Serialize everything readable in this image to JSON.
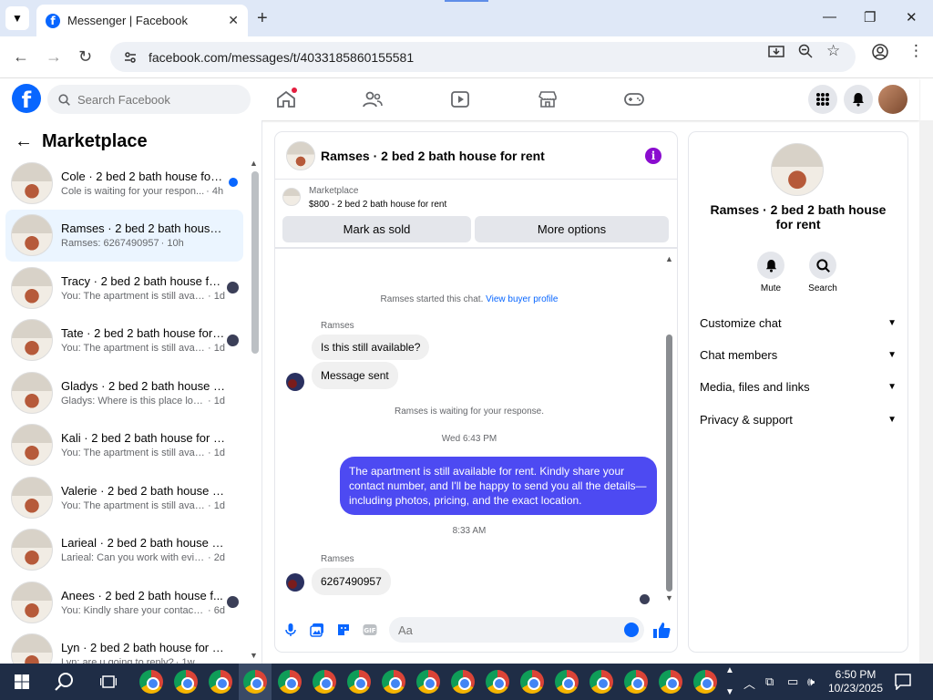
{
  "browser": {
    "tab_title": "Messenger | Facebook",
    "url": "facebook.com/messages/t/4033185860155581"
  },
  "header": {
    "search_placeholder": "Search Facebook"
  },
  "sidebar": {
    "title": "Marketplace",
    "conversations": [
      {
        "name": "Cole · 2 bed 2 bath house for ...",
        "preview": "Cole is waiting for your respon...",
        "time": "· 4h",
        "status": "unread"
      },
      {
        "name": "Ramses · 2 bed 2 bath house fo...",
        "preview": "Ramses: 6267490957",
        "time": "· 10h",
        "status": "active"
      },
      {
        "name": "Tracy · 2 bed 2 bath house fo...",
        "preview": "You: The apartment is still availa...",
        "time": "· 1d",
        "status": "seen"
      },
      {
        "name": "Tate · 2 bed 2 bath house for ...",
        "preview": "You: The apartment is still availa...",
        "time": "· 1d",
        "status": "seen"
      },
      {
        "name": "Gladys · 2 bed 2 bath house for ...",
        "preview": "Gladys: Where is this place located...",
        "time": "· 1d",
        "status": "none"
      },
      {
        "name": "Kali · 2 bed 2 bath house for rent",
        "preview": "You: The apartment is still available...",
        "time": "· 1d",
        "status": "none"
      },
      {
        "name": "Valerie · 2 bed 2 bath house for ...",
        "preview": "You: The apartment is still available...",
        "time": "· 1d",
        "status": "none"
      },
      {
        "name": "Larieal · 2 bed 2 bath house for ...",
        "preview": "Larieal: Can you work with evictions",
        "time": "· 2d",
        "status": "none"
      },
      {
        "name": "Anees · 2 bed 2 bath house f...",
        "preview": "You: Kindly share your contact ...",
        "time": "· 6d",
        "status": "seen"
      },
      {
        "name": "Lyn · 2 bed 2 bath house for rent",
        "preview": "Lyn: are u going to reply?",
        "time": "· 1w",
        "status": "none"
      }
    ]
  },
  "chat": {
    "title": "Ramses · 2 bed 2 bath house for rent",
    "marketplace_label": "Marketplace",
    "listing": "$800 - 2 bed 2 bath house for rent",
    "mark_sold": "Mark as sold",
    "more_options": "More options",
    "started_text": "Ramses started this chat.",
    "view_buyer": "View buyer profile",
    "sender_name": "Ramses",
    "msg1": "Is this still available?",
    "msg2": "Message sent",
    "waiting": "Ramses is waiting for your response.",
    "ts1": "Wed 6:43 PM",
    "out_msg": "The apartment is still available for rent. Kindly share your contact number, and I'll be happy to send you all the details—including photos, pricing, and the exact location.",
    "ts2": "8:33 AM",
    "sender_name2": "Ramses",
    "msg3": "6267490957",
    "composer_placeholder": "Aa"
  },
  "right_panel": {
    "title": "Ramses · 2 bed 2 bath house for rent",
    "mute": "Mute",
    "search": "Search",
    "sections": [
      "Customize chat",
      "Chat members",
      "Media, files and links",
      "Privacy & support"
    ]
  },
  "taskbar": {
    "time": "6:50 PM",
    "date": "10/23/2025"
  },
  "colors": {
    "fb_blue": "#0866ff",
    "outgoing_bubble": "#4d4af2",
    "info_purple": "#8a0ccf"
  }
}
